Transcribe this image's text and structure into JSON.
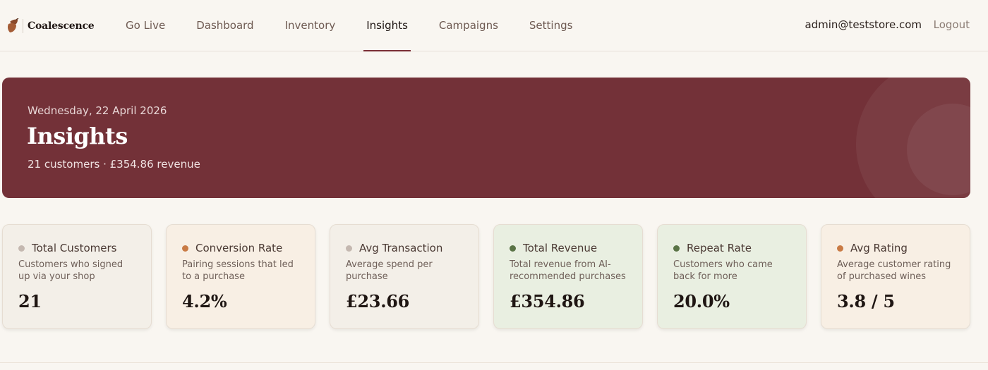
{
  "brand": {
    "name": "Coalescence",
    "icon": "acorn-icon"
  },
  "nav": {
    "items": [
      {
        "label": "Go Live"
      },
      {
        "label": "Dashboard"
      },
      {
        "label": "Inventory"
      },
      {
        "label": "Insights"
      },
      {
        "label": "Campaigns"
      },
      {
        "label": "Settings"
      }
    ],
    "active": "Insights"
  },
  "user": {
    "email": "admin@teststore.com",
    "logout_label": "Logout"
  },
  "hero": {
    "date": "Wednesday, 22 April 2026",
    "title": "Insights",
    "subtitle": "21 customers · £354.86 revenue"
  },
  "cards": [
    {
      "title": "Total Customers",
      "desc": "Customers who signed up via your shop",
      "value": "21",
      "bg": "#f3efe8",
      "dot": "#c4b8b0"
    },
    {
      "title": "Conversion Rate",
      "desc": "Pairing sessions that led to a purchase",
      "value": "4.2%",
      "bg": "#f8efe4",
      "dot": "#c97b45"
    },
    {
      "title": "Avg Transaction",
      "desc": "Average spend per purchase",
      "value": "£23.66",
      "bg": "#f3efe8",
      "dot": "#c4b8b0"
    },
    {
      "title": "Total Revenue",
      "desc": "Total revenue from AI-recommended purchases",
      "value": "£354.86",
      "bg": "#e9efe1",
      "dot": "#5a7446"
    },
    {
      "title": "Repeat Rate",
      "desc": "Customers who came back for more",
      "value": "20.0%",
      "bg": "#e9efe1",
      "dot": "#5a7446"
    },
    {
      "title": "Avg Rating",
      "desc": "Average customer rating of purchased wines",
      "value": "3.8 / 5",
      "bg": "#f8efe4",
      "dot": "#c97b45"
    }
  ],
  "colors": {
    "accent": "#733138",
    "background": "#f9f6f1"
  }
}
